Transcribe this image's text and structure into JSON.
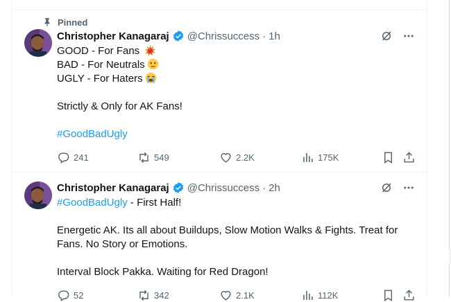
{
  "tweets": [
    {
      "pinned_label": "Pinned",
      "name": "Christopher Kanagaraj",
      "handle": "@Chrissuccess",
      "time": "1h",
      "lines": [
        {
          "text": "GOOD - For Fans ",
          "emoji": "collision-emoji"
        },
        {
          "text": "BAD - For Neutrals",
          "emoji": "neutral-face-emoji"
        },
        {
          "text": "UGLY - For Haters",
          "emoji": "crying-face-emoji"
        },
        {
          "text": ""
        },
        {
          "text": "Strictly & Only for AK Fans!"
        },
        {
          "text": ""
        },
        {
          "hashtag": "#GoodBadUgly"
        }
      ],
      "replies": "241",
      "reposts": "549",
      "likes": "2.2K",
      "views": "175K"
    },
    {
      "name": "Christopher Kanagaraj",
      "handle": "@Chrissuccess",
      "time": "2h",
      "first_line": {
        "hashtag": "#GoodBadUgly",
        "text": " - First Half!"
      },
      "lines": [
        {
          "text": ""
        },
        {
          "text": "Energetic AK. Its all about Buildups, Slow Motion Walks & Fights. Treat for"
        },
        {
          "text": "Fans. No Story or Emotions."
        },
        {
          "text": ""
        },
        {
          "text": "Interval Block Pakka. Waiting for Red Dragon!"
        }
      ],
      "replies": "52",
      "reposts": "342",
      "likes": "2.1K",
      "views": "112K"
    }
  ],
  "dot": "·",
  "colors": {
    "link": "#1d9bf0",
    "muted": "#536471",
    "verified": "#1d9bf0"
  }
}
